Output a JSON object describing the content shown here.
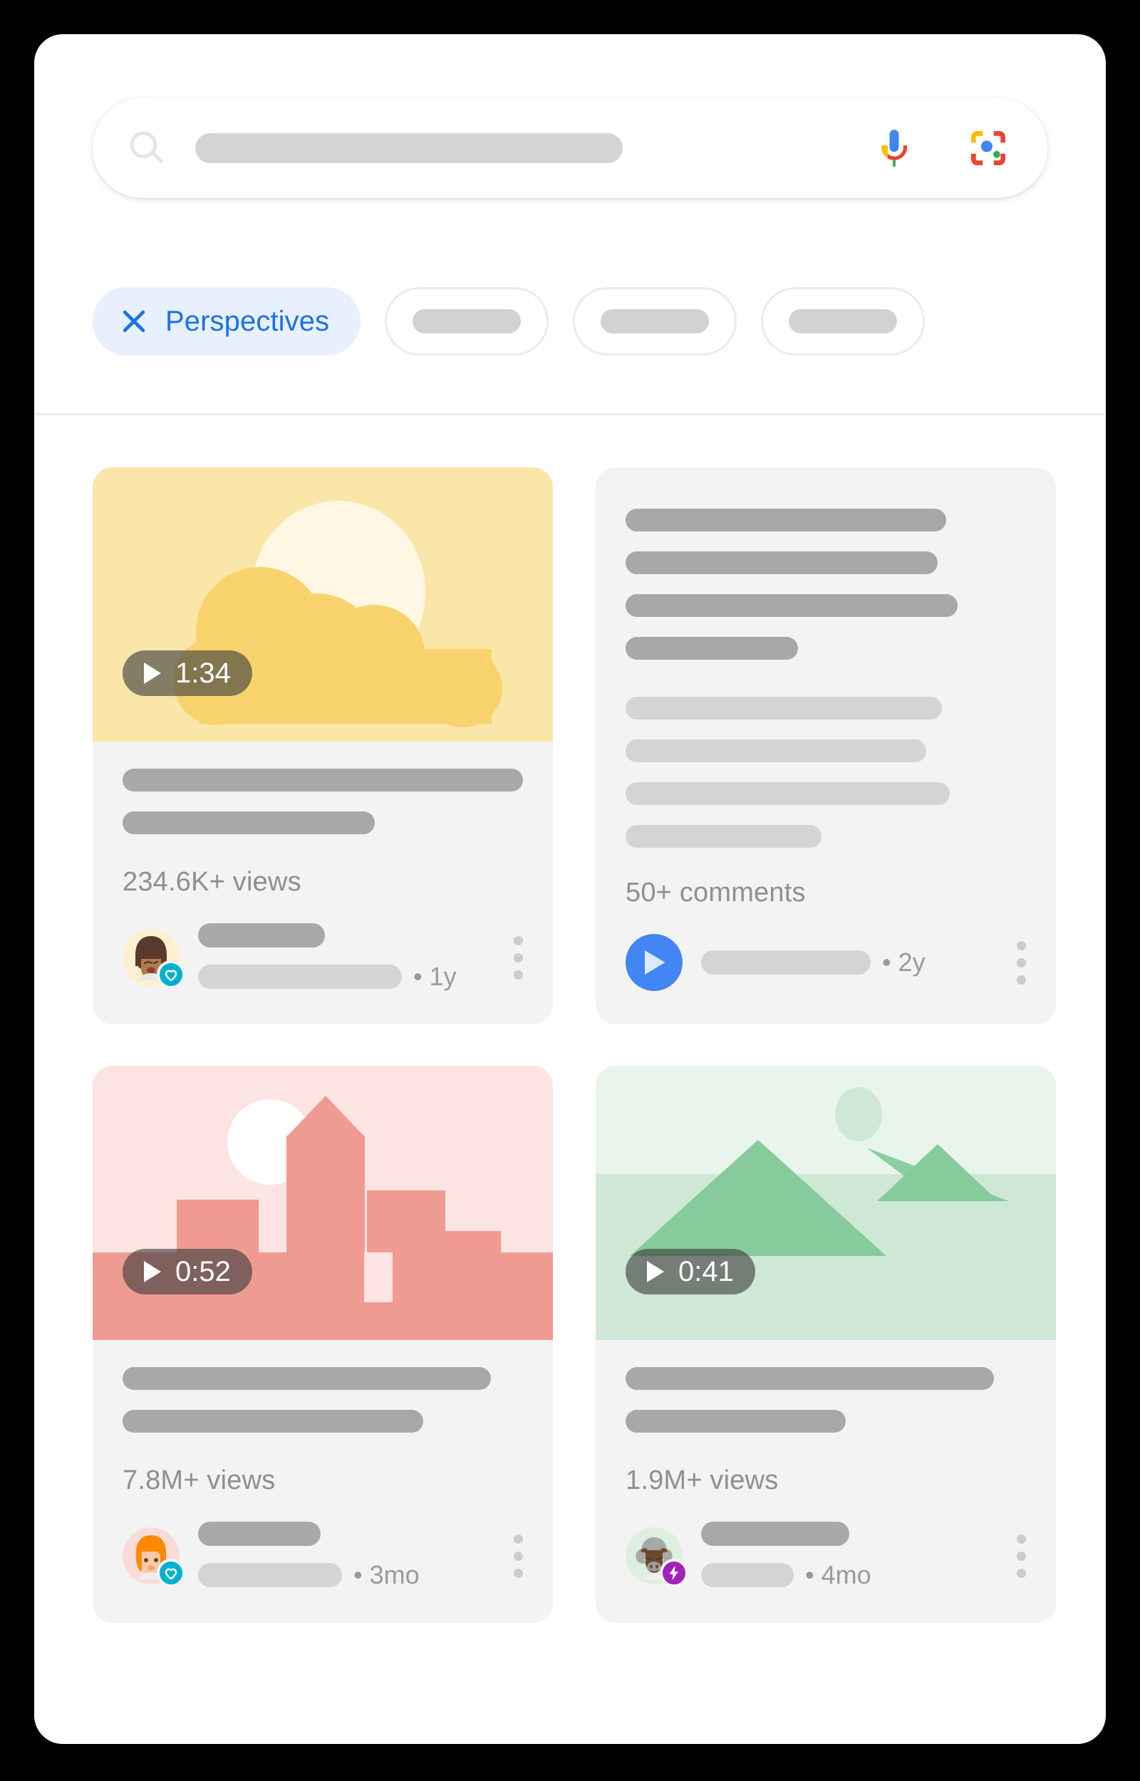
{
  "theme": {
    "page_background": "#000000",
    "panel_background": "#ffffff",
    "card_background": "#f3f3f3",
    "accent_blue": "#1a73e8",
    "chip_active_background": "#e8f0fe",
    "badge_heart_color": "#00b0d0",
    "badge_bolt_color": "#a321b8",
    "source_avatar_color": "#4285f4"
  },
  "search": {
    "icon": "search-icon",
    "query_value": "",
    "placeholder": "",
    "mic_icon": "microphone-icon",
    "lens_icon": "google-lens-icon"
  },
  "filters": {
    "chips": [
      {
        "label": "Perspectives",
        "active": true,
        "icon": "close-icon"
      },
      {
        "label": "",
        "active": false
      },
      {
        "label": "",
        "active": false
      },
      {
        "label": "",
        "active": false
      }
    ]
  },
  "results": [
    {
      "id": "card-1",
      "kind": "video",
      "thumbnail": "sun-and-clouds-illustration",
      "duration": "1:34",
      "play_icon": "play-icon",
      "stat": "234.6K+ views",
      "time_ago": "• 1y",
      "avatar": "woman-brown-hair-avatar",
      "badge": "heart-badge-icon",
      "menu_icon": "more-options-icon",
      "title_lines": 2
    },
    {
      "id": "card-2",
      "kind": "discussion",
      "thumbnail": null,
      "duration": null,
      "stat": "50+ comments",
      "time_ago": "• 2y",
      "avatar": "google-play-source-icon",
      "badge": null,
      "menu_icon": "more-options-icon",
      "title_lines": 4,
      "snippet_lines": 4
    },
    {
      "id": "card-3",
      "kind": "video",
      "thumbnail": "city-skyline-illustration",
      "duration": "0:52",
      "play_icon": "play-icon",
      "stat": "7.8M+ views",
      "time_ago": "• 3mo",
      "avatar": "woman-orange-hair-avatar",
      "badge": "heart-badge-icon",
      "menu_icon": "more-options-icon",
      "title_lines": 2
    },
    {
      "id": "card-4",
      "kind": "video",
      "thumbnail": "mountains-illustration",
      "duration": "0:41",
      "play_icon": "play-icon",
      "stat": "1.9M+ views",
      "time_ago": "• 4mo",
      "avatar": "bull-avatar",
      "badge": "bolt-badge-icon",
      "menu_icon": "more-options-icon",
      "title_lines": 2
    }
  ]
}
